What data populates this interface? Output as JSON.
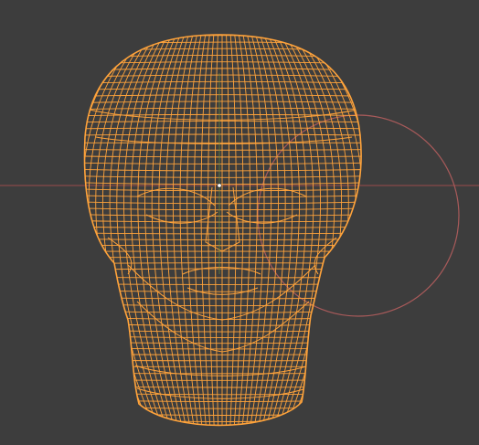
{
  "viewport": {
    "mode": "wireframe",
    "background_color": "#3d3d3d",
    "x_axis_color": "#9a4a4a",
    "y_axis_color": "#6a8a3a",
    "selection_color": "#ffa33b",
    "gizmo_circle_color": "#a85a5a",
    "origin_color": "#ffffff"
  },
  "object": {
    "name_icon": "head-mesh-wireframe-icon",
    "selected": true
  }
}
